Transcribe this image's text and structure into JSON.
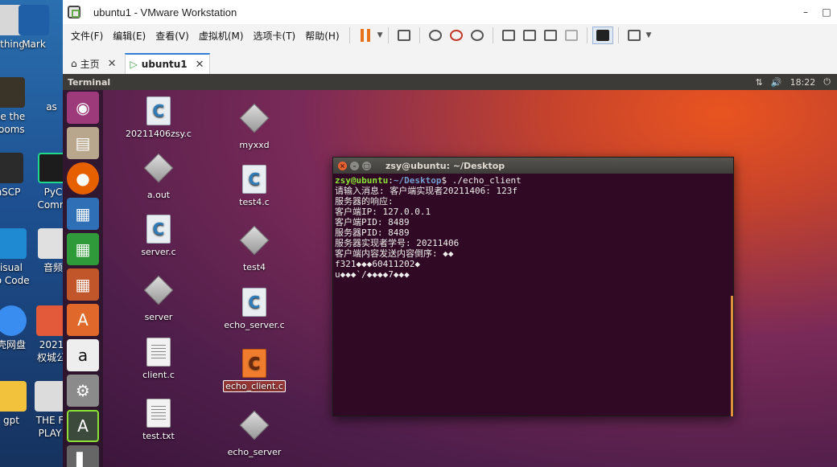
{
  "host": {
    "icons": [
      {
        "label": "...ything...",
        "name": "everything-icon"
      },
      {
        "label": "Mark",
        "name": "markdown-app-icon"
      },
      {
        "label": "de the",
        "name": "game-shortcut-icon"
      },
      {
        "label": "rooms",
        "name": "game-shortcut-icon-line2"
      },
      {
        "label": "as",
        "name": "host-shortcut-as-icon"
      },
      {
        "label": "nSCP",
        "name": "winscp-icon"
      },
      {
        "label": "PyC",
        "name": "pycharm-icon"
      },
      {
        "label": "Comm",
        "name": "pycharm-icon-line2"
      },
      {
        "label": "isual",
        "name": "vscode-icon"
      },
      {
        "label": "io Code",
        "name": "vscode-icon-line2"
      },
      {
        "label": "音频",
        "name": "audio-icon"
      },
      {
        "label": "壳网盘",
        "name": "cloud-drive-icon"
      },
      {
        "label": "2021",
        "name": "doc-2021-icon"
      },
      {
        "label": "权城公",
        "name": "doc-2021-icon-line2"
      },
      {
        "label": "gpt",
        "name": "folder-gpt-icon"
      },
      {
        "label": "THE F",
        "name": "the-f-icon"
      },
      {
        "label": "PLAY",
        "name": "the-f-icon-line2"
      }
    ]
  },
  "vmware": {
    "title": "ubuntu1 - VMware Workstation",
    "menu": [
      "文件(F)",
      "编辑(E)",
      "查看(V)",
      "虚拟机(M)",
      "选项卡(T)",
      "帮助(H)"
    ],
    "tabs": [
      {
        "label": "主页",
        "icon": "home-icon"
      },
      {
        "label": "ubuntu1",
        "icon": "vm-play-icon"
      }
    ]
  },
  "guest": {
    "topbar_title": "Terminal",
    "time": "18:22",
    "desktop_files": [
      {
        "label": "20211406zsy.c",
        "type": "c"
      },
      {
        "label": "a.out",
        "type": "exec"
      },
      {
        "label": "server.c",
        "type": "c"
      },
      {
        "label": "server",
        "type": "exec"
      },
      {
        "label": "client.c",
        "type": "txt"
      },
      {
        "label": "test.txt",
        "type": "txt"
      },
      {
        "label": "myxxd",
        "type": "exec"
      },
      {
        "label": "test4.c",
        "type": "c"
      },
      {
        "label": "test4",
        "type": "exec"
      },
      {
        "label": "echo_server.c",
        "type": "c"
      },
      {
        "label": "echo_client.c",
        "type": "c-selected"
      },
      {
        "label": "echo_server",
        "type": "exec"
      }
    ]
  },
  "terminal": {
    "title": "zsy@ubuntu: ~/Desktop",
    "prompt_user": "zsy@ubuntu",
    "prompt_colon": ":",
    "prompt_path": "~/Desktop",
    "prompt_command": "$ ./echo_client",
    "lines": [
      "请输入消息: 客户端实现者20211406: 123f",
      "服务器的响应:",
      "客户端IP: 127.0.0.1",
      "客户端PID: 8489",
      "服务器PID: 8489",
      "服务器实现者学号: 20211406",
      "客户端内容发送内容倒序: ◆◆",
      "f321◆◆◆60411202◆",
      "u◆◆◆`/◆◆◆◆7◆◆◆"
    ]
  }
}
